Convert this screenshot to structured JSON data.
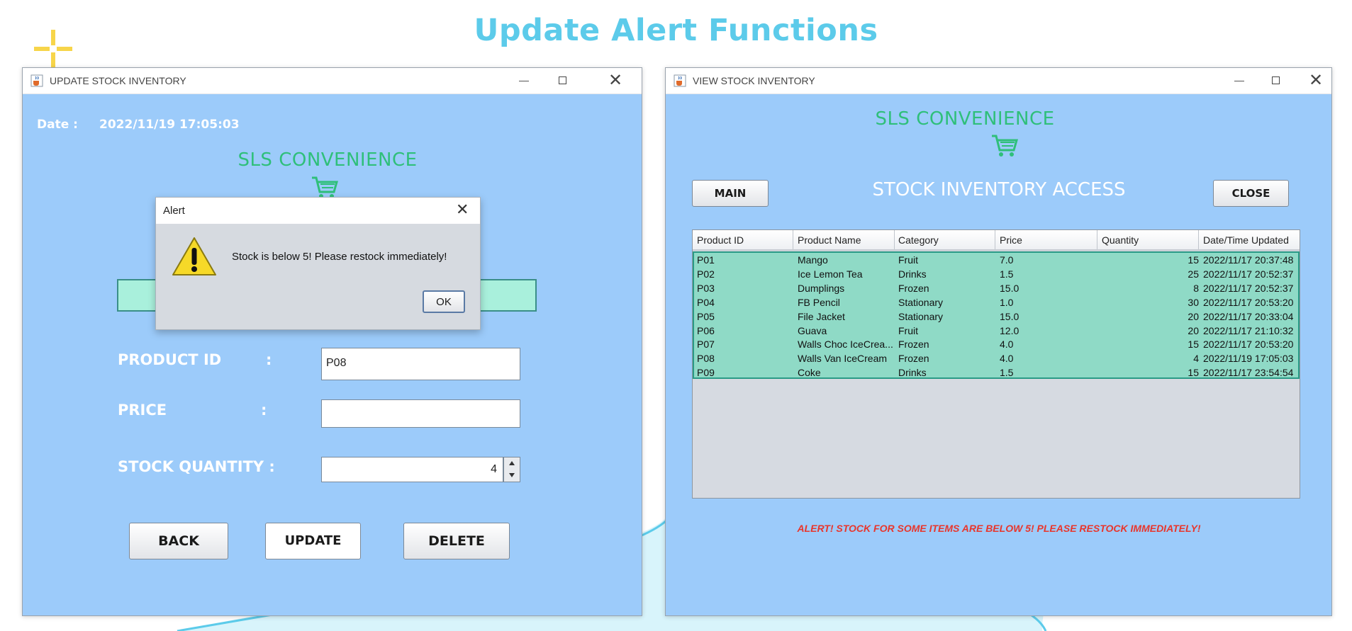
{
  "slide": {
    "title": "Update Alert Functions"
  },
  "update_window": {
    "title": "UPDATE STOCK INVENTORY",
    "date_label": "Date :",
    "date_value": "2022/11/19 17:05:03",
    "brand": "SLS CONVENIENCE",
    "product_id_label": "PRODUCT ID",
    "price_label": "PRICE",
    "colon": ":",
    "stock_qty_label": "STOCK QUANTITY :",
    "product_id_value": "P08",
    "price_value": "",
    "stock_qty_value": "4",
    "back_label": "BACK",
    "update_label": "UPDATE",
    "delete_label": "DELETE",
    "min_glyph": "—",
    "close_glyph": "✕"
  },
  "alert_dialog": {
    "title": "Alert",
    "message": "Stock is below 5! Please restock immediately!",
    "ok_label": "OK",
    "close_glyph": "✕"
  },
  "view_window": {
    "title": "VIEW STOCK INVENTORY",
    "brand": "SLS CONVENIENCE",
    "heading": "STOCK INVENTORY ACCESS",
    "main_label": "MAIN",
    "close_label": "CLOSE",
    "alert_text": "ALERT! STOCK FOR SOME ITEMS ARE BELOW 5! PLEASE RESTOCK IMMEDIATELY!",
    "min_glyph": "—",
    "close_glyph": "✕",
    "table": {
      "headers": [
        "Product ID",
        "Product Name",
        "Category",
        "Price",
        "Quantity",
        "Date/Time Updated"
      ],
      "rows": [
        [
          "P01",
          "Mango",
          "Fruit",
          "7.0",
          "15",
          "2022/11/17 20:37:48"
        ],
        [
          "P02",
          "Ice Lemon Tea",
          "Drinks",
          "1.5",
          "25",
          "2022/11/17 20:52:37"
        ],
        [
          "P03",
          "Dumplings",
          "Frozen",
          "15.0",
          "8",
          "2022/11/17 20:52:37"
        ],
        [
          "P04",
          "FB Pencil",
          "Stationary",
          "1.0",
          "30",
          "2022/11/17 20:53:20"
        ],
        [
          "P05",
          "File Jacket",
          "Stationary",
          "15.0",
          "20",
          "2022/11/17 20:33:04"
        ],
        [
          "P06",
          "Guava",
          "Fruit",
          "12.0",
          "20",
          "2022/11/17 21:10:32"
        ],
        [
          "P07",
          "Walls Choc IceCrea...",
          "Frozen",
          "4.0",
          "15",
          "2022/11/17 20:53:20"
        ],
        [
          "P08",
          "Walls Van IceCream",
          "Frozen",
          "4.0",
          "4",
          "2022/11/19 17:05:03"
        ],
        [
          "P09",
          "Coke",
          "Drinks",
          "1.5",
          "15",
          "2022/11/17 23:54:54"
        ]
      ]
    }
  },
  "colors": {
    "window_bg": "#9ccbfa",
    "brand_green": "#2fbf7a",
    "title_cyan": "#5ccbea",
    "table_selection": "#8fdac6",
    "alert_red": "#e8362c"
  },
  "icons": {
    "app": "java-cup-icon",
    "cart": "shopping-cart-icon",
    "warning": "warning-triangle-icon",
    "sparkle": "sparkle-icon"
  }
}
